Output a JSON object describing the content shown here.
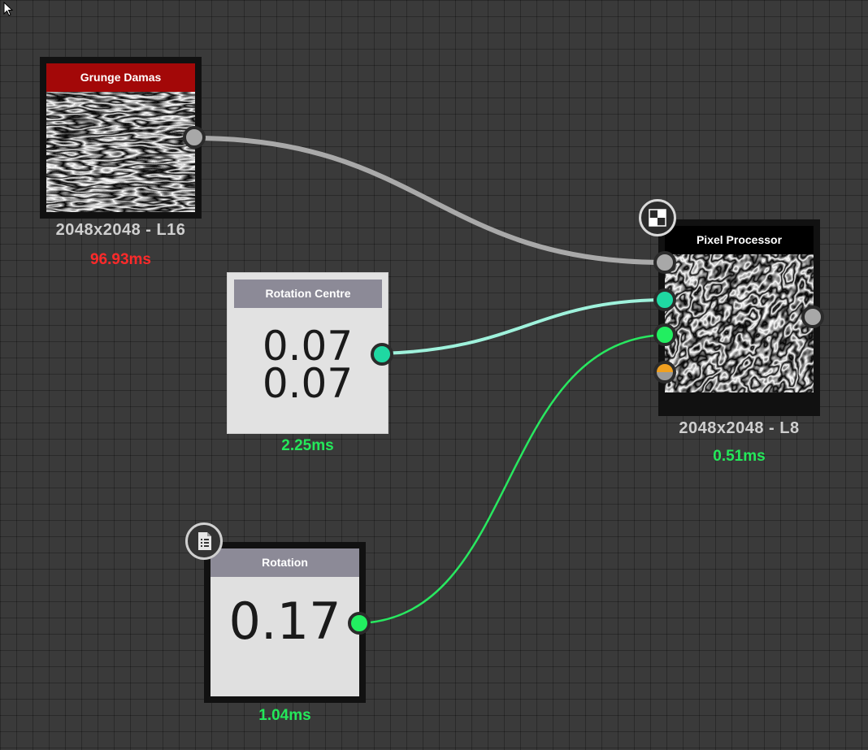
{
  "nodes": {
    "grunge": {
      "title": "Grunge Damas",
      "title_color": "#a30808",
      "resolution": "2048x2048 - L16",
      "time": "96.93ms",
      "time_color": "#ff2a2a"
    },
    "rotation_centre": {
      "title": "Rotation Centre",
      "value_x": "0.07",
      "value_y": "0.07",
      "time": "2.25ms",
      "time_color": "#24e85a"
    },
    "pixel_processor": {
      "title": "Pixel Processor",
      "resolution": "2048x2048 - L8",
      "time": "0.51ms",
      "time_color": "#24e85a",
      "badge_icon": "checker-icon"
    },
    "rotation": {
      "title": "Rotation",
      "value": "0.17",
      "time": "1.04ms",
      "time_color": "#24e85a",
      "badge_icon": "document-list-icon"
    }
  },
  "port_colors": {
    "grayscale": "#a8a8a8",
    "float2": "#1fd8a2",
    "float1": "#22ee60",
    "mixed_top": "#9a9a9a",
    "mixed_bottom": "#f0a020"
  },
  "wire_colors": {
    "grayscale": "#a9a9a9",
    "float2": "#9ff2dc",
    "float1": "#28e860"
  },
  "icons": {
    "cursor": "cursor-arrow-icon"
  }
}
